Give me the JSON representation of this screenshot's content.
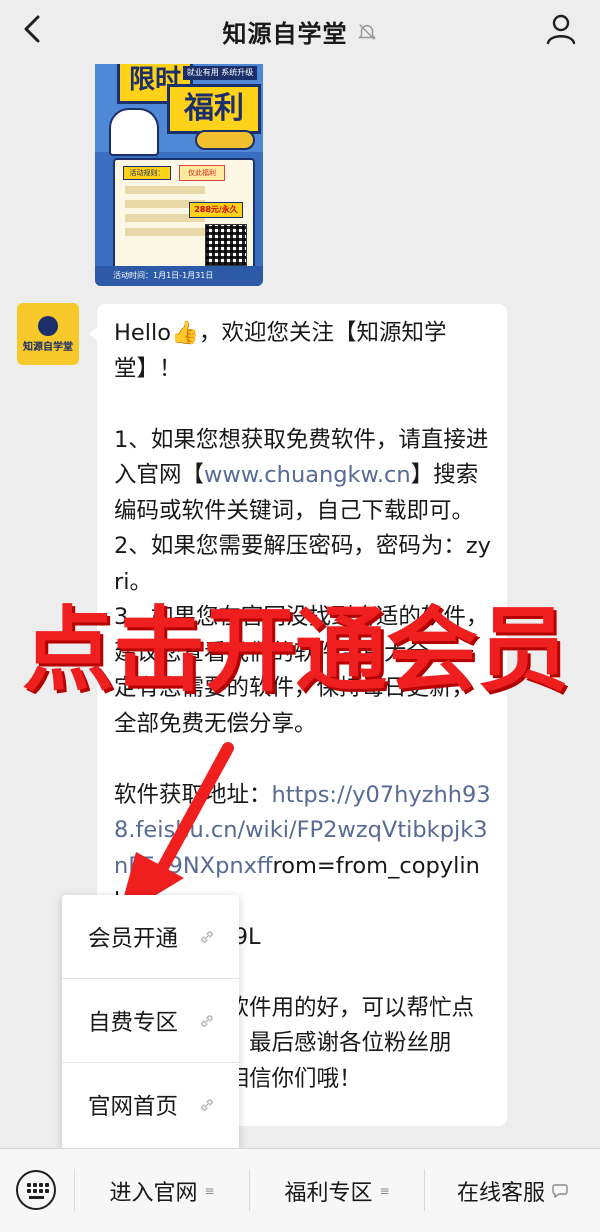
{
  "header": {
    "title": "知源自学堂"
  },
  "poster": {
    "headline_top": "限时",
    "headline_main": "福利",
    "badge": "就业有用 系统升级",
    "rules_head": "活动规则：",
    "rules_tag": "仅此福利",
    "price": "288元/永久",
    "foot": "活动时间：1月1日-1月31日"
  },
  "avatar": {
    "label": "知源自学堂"
  },
  "message": {
    "part1": "Hello👍，欢迎您关注【知源知学堂】！\n\n1、如果您想获取免费软件，请直接进入官网【",
    "link1": "www.chuangkw.cn",
    "part2": "】搜索编码或软件关键词，自己下载即可。\n2、如果您需要解压密码，密码为：zyri。\n3、如果您在官网没找到合适的软件，建议您查看我们的软件合集大全，一定有您需要的软件，保持每日更新，全部免费无偿分享。\n\n软件获取地址：",
    "link2": "https://y07hyzhh938.feishu.cn/wiki/FP2wzqVtibkpjk3nP5c9NXpnxf",
    "part3": "from=from_copylink\n提取码：Z49L\n\n最后，如果软件用的好，可以帮忙点赞评论转发！最后感谢各位粉丝朋友！让我们相信你们哦！"
  },
  "overlay": {
    "text": "点击开通会员"
  },
  "popup_menu": {
    "items": [
      {
        "label": "会员开通"
      },
      {
        "label": "自费专区"
      },
      {
        "label": "官网首页"
      }
    ]
  },
  "bottom_menu": {
    "items": [
      {
        "label": "进入官网",
        "icon": "list-icon"
      },
      {
        "label": "福利专区",
        "icon": "list-icon"
      },
      {
        "label": "在线客服",
        "icon": "chat-bubble-icon"
      }
    ]
  },
  "colors": {
    "background": "#ededed",
    "link": "#576b95",
    "overlay_red": "#ef1f1f"
  }
}
